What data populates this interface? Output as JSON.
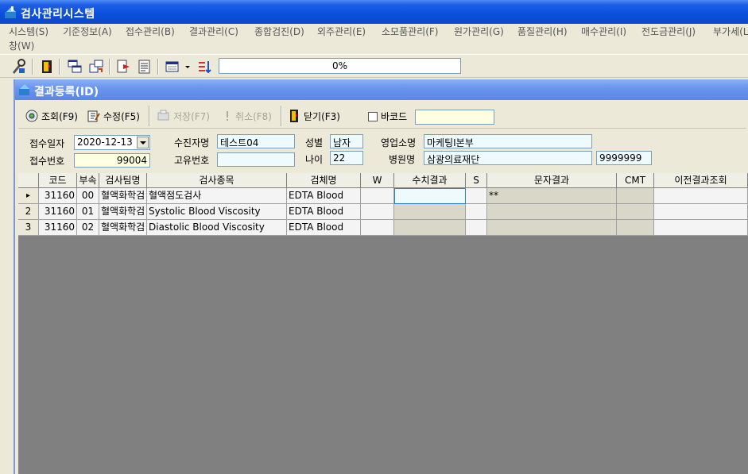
{
  "app": {
    "title": "검사관리시스템"
  },
  "menu": {
    "items": [
      "시스템(S)",
      "기준정보(A)",
      "접수관리(B)",
      "결과관리(C)",
      "종합검진(D)",
      "외주관리(E)",
      "소모품관리(F)",
      "원가관리(G)",
      "품질관리(H)",
      "매수관리(I)",
      "전도금관리(J)",
      "부가세(L",
      "창(W)"
    ]
  },
  "toolbar": {
    "progress_text": "0%"
  },
  "child": {
    "title": "결과등록(ID)",
    "buttons": {
      "search": "조회(F9)",
      "edit": "수정(F5)",
      "save": "저장(F7)",
      "cancel": "취소(F8)",
      "close": "닫기(F3)"
    },
    "barcode_label": "바코드"
  },
  "form": {
    "receipt_date_label": "접수일자",
    "receipt_date": "2020-12-13",
    "receipt_no_label": "접수번호",
    "receipt_no": "99004",
    "patient_label": "수진자명",
    "patient": "테스트04",
    "unique_no_label": "고유번호",
    "unique_no": "",
    "gender_label": "성별",
    "gender": "남자",
    "age_label": "나이",
    "age": "22",
    "sales_label": "영업소명",
    "sales": "마케팅Ⅰ본부",
    "hospital_label": "병원명",
    "hospital": "삼광의료재단",
    "hospital_code": "9999999"
  },
  "grid": {
    "headers": [
      "",
      "코드",
      "부속",
      "검사팀명",
      "검사종목",
      "검체명",
      "W",
      "수치결과",
      "S",
      "문자결과",
      "CMT",
      "이전결과조회"
    ],
    "rows": [
      {
        "rh": "▸",
        "code": "31160",
        "sub": "00",
        "team": "혈액화학검",
        "item": "혈액점도검사",
        "specimen": "EDTA Blood",
        "w": "",
        "num": "",
        "s": "",
        "text": "**",
        "cmt": "",
        "prev": ""
      },
      {
        "rh": "2",
        "code": "31160",
        "sub": "01",
        "team": "혈액화학검",
        "item": "Systolic Blood Viscosity",
        "specimen": "EDTA Blood",
        "w": "",
        "num": "",
        "s": "",
        "text": "",
        "cmt": "",
        "prev": ""
      },
      {
        "rh": "3",
        "code": "31160",
        "sub": "02",
        "team": "혈액화학검",
        "item": "Diastolic Blood Viscosity",
        "specimen": "EDTA Blood",
        "w": "",
        "num": "",
        "s": "",
        "text": "",
        "cmt": "",
        "prev": ""
      }
    ]
  },
  "colors": {
    "title_blue": "#0a4fdc",
    "child_title": "#6a96ee",
    "field_bg": "#eefafc",
    "grid_bg": "#808080"
  }
}
